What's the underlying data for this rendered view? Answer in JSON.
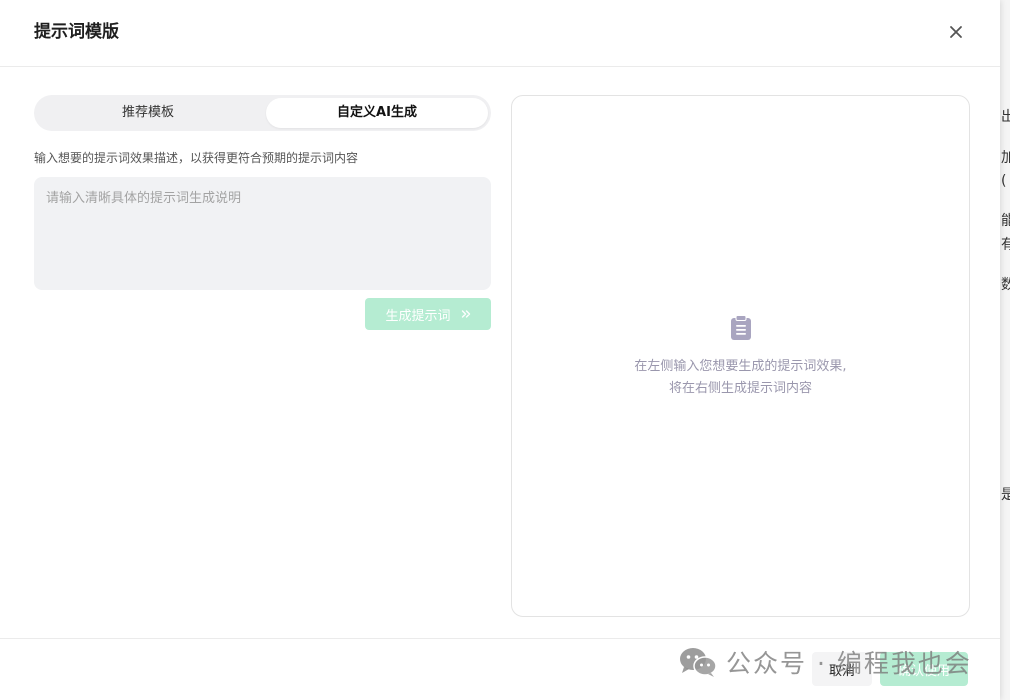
{
  "dialog": {
    "title": "提示词模版",
    "tabs": [
      {
        "label": "推荐模板",
        "active": false
      },
      {
        "label": "自定义AI生成",
        "active": true
      }
    ],
    "description": "输入想要的提示词效果描述，以获得更符合预期的提示词内容",
    "input": {
      "placeholder": "请输入清晰具体的提示词生成说明",
      "value": ""
    },
    "generate_button": {
      "label": "生成提示词",
      "icon": "double-chevron-right-icon",
      "enabled": false
    },
    "preview": {
      "icon": "clipboard-icon",
      "empty_line1": "在左侧输入您想要生成的提示词效果,",
      "empty_line2": "将在右侧生成提示词内容"
    },
    "footer": {
      "cancel_label": "取消",
      "confirm_label": "确认使用",
      "confirm_enabled": false
    }
  },
  "background_fragments": [
    "出",
    "加",
    "(",
    "能",
    "有",
    "数",
    "是"
  ],
  "watermark": {
    "text": "公众号 · 编程我也会",
    "icon": "wechat-icon"
  },
  "colors": {
    "accent_disabled": "#b5ecd2",
    "icon_muted": "#a9a5c0",
    "input_bg": "#f1f2f4"
  }
}
